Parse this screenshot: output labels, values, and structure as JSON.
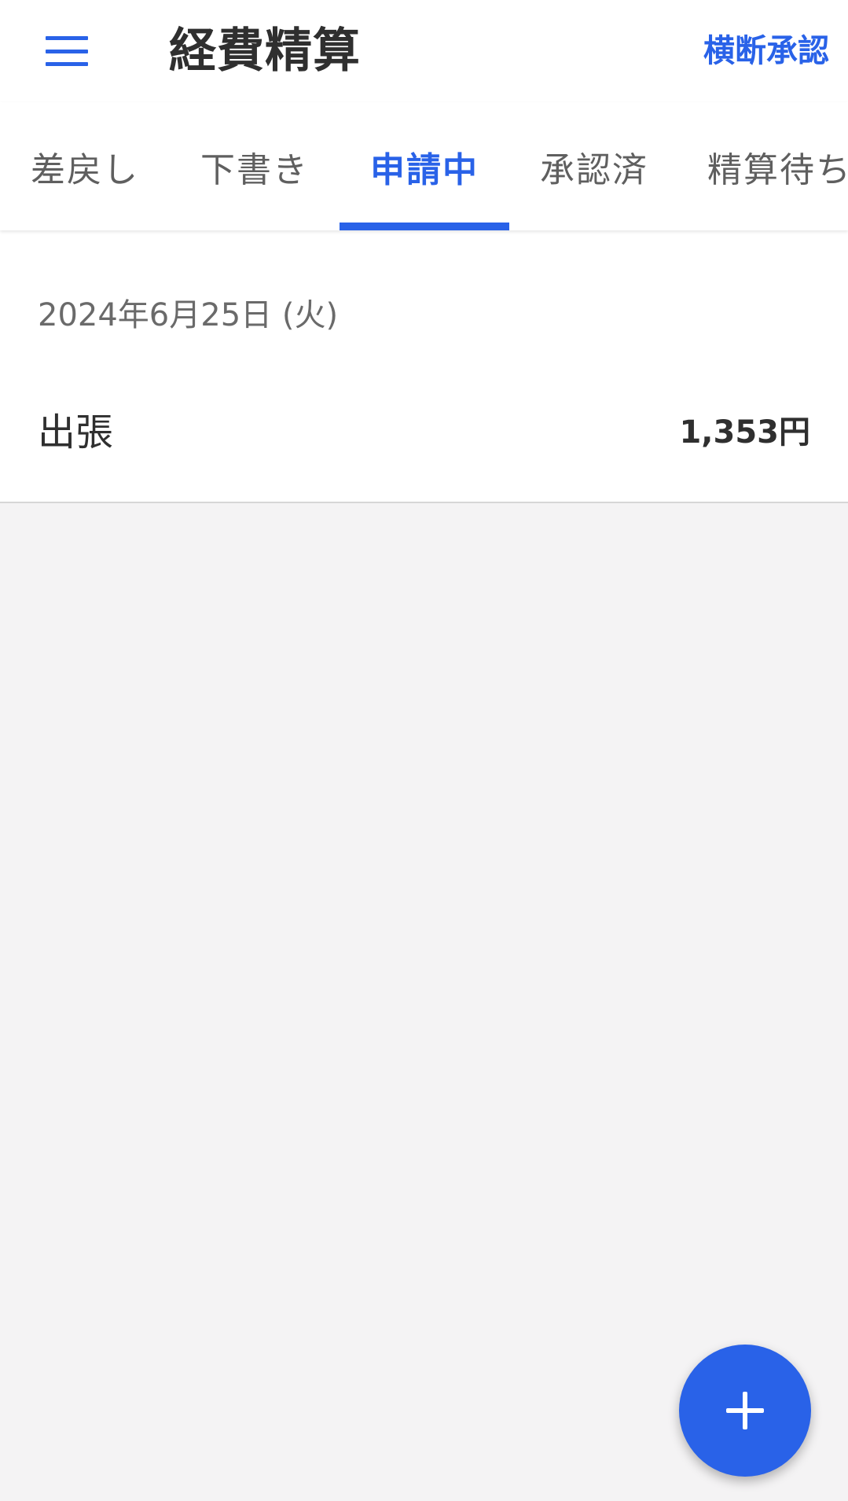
{
  "header": {
    "title": "経費精算",
    "cross_approve_label": "横断承認",
    "menu_icon": "hamburger-menu-icon"
  },
  "tabs": [
    {
      "label": "差戻し"
    },
    {
      "label": "下書き"
    },
    {
      "label": "申請中",
      "active": true
    },
    {
      "label": "承認済"
    },
    {
      "label": "精算待ち"
    }
  ],
  "list": {
    "date_header": "2024年6月25日 (火)",
    "items": [
      {
        "name": "出張",
        "amount": "1,353円"
      }
    ]
  },
  "fab": {
    "icon": "plus-icon"
  },
  "colors": {
    "accent": "#2962e8",
    "background": "#f4f3f4",
    "surface": "#ffffff",
    "text_primary": "#2f2f2f",
    "text_secondary": "#6a6a6a"
  }
}
